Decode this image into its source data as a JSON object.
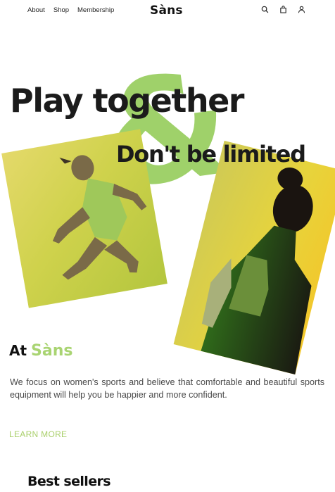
{
  "nav": {
    "links": [
      "About",
      "Shop",
      "Membership"
    ],
    "brand": "Sàns",
    "icons": [
      "search-icon",
      "bag-icon",
      "user-icon"
    ]
  },
  "hero": {
    "title": "Play together",
    "ampersand": "&",
    "subtitle": "Don't be limited"
  },
  "about": {
    "prefix": "At",
    "brand": "Sàns",
    "text": "We focus on women's sports and believe that comfortable and beautiful sports equipment will help you be happier and more confident.",
    "cta": "LEARN MORE"
  },
  "best_sellers": {
    "title": "Best sellers"
  },
  "colors": {
    "accent": "#a9d472",
    "text": "#1b1b1b"
  }
}
